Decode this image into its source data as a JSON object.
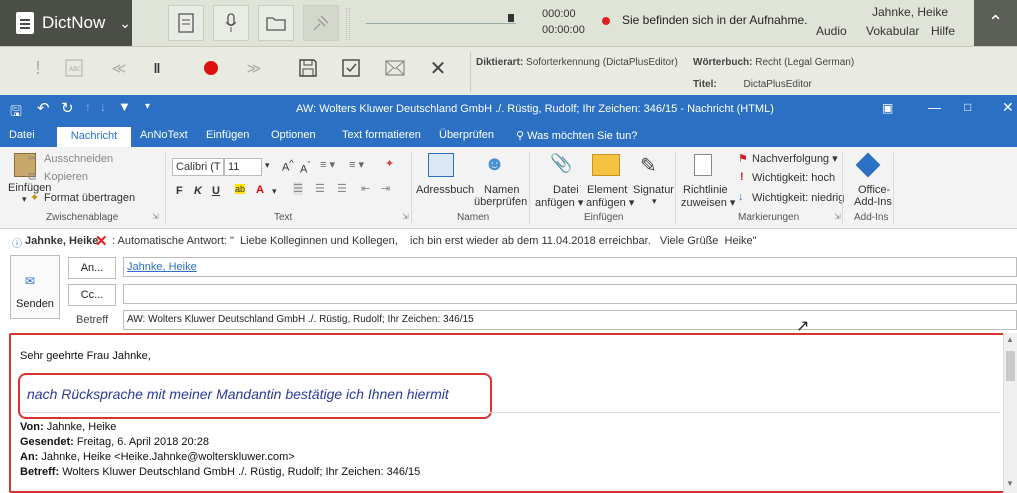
{
  "dictnow": {
    "app_name": "DictNow",
    "time_elapsed": "000:00",
    "time_total": "00:00:00",
    "status_text": "Sie befinden sich in der Aufnahme.",
    "user_name": "Jahnke, Heike",
    "menu": [
      "Audio",
      "Vokabular",
      "Hilfe"
    ],
    "dictation_type_label": "Diktierart:",
    "dictation_type_value": "Soforterkennung (DictaPlusEditor)",
    "dictionary_label": "Wörterbuch:",
    "dictionary_value": "Recht (Legal German)",
    "title_label": "Titel:",
    "title_value": "DictaPlusEditor"
  },
  "outlook": {
    "window_title": "AW: Wolters Kluwer Deutschland GmbH ./. Rüstig, Rudolf; Ihr Zeichen: 346/15 - Nachricht (HTML)",
    "tabs": [
      "Datei",
      "Nachricht",
      "AnNoText",
      "Einfügen",
      "Optionen",
      "Text formatieren",
      "Überprüfen",
      "Was möchten Sie tun?"
    ],
    "ribbon": {
      "paste": "Einfügen",
      "cut": "Ausschneiden",
      "copy": "Kopieren",
      "format_painter": "Format übertragen",
      "font_name": "Calibri (T",
      "font_size": "11",
      "addressbook": "Adressbuch",
      "check_names_1": "Namen",
      "check_names_2": "überprüfen",
      "attach_file_1": "Datei",
      "attach_file_2": "anfügen",
      "attach_item_1": "Element",
      "attach_item_2": "anfügen",
      "signature": "Signatur",
      "policy_1": "Richtlinie",
      "policy_2": "zuweisen",
      "follow_up": "Nachverfolgung",
      "high_importance": "Wichtigkeit: hoch",
      "low_importance": "Wichtigkeit: niedrig",
      "office_addins_1": "Office-",
      "office_addins_2": "Add-Ins",
      "groups": [
        "Zwischenablage",
        "Text",
        "Namen",
        "Einfügen",
        "Markierungen",
        "Add-Ins"
      ]
    },
    "autoreply_sender": "Jahnke, Heike",
    "autoreply_text": ": Automatische Antwort: \"  Liebe Kolleginnen und Kollegen,    ich bin erst wieder ab dem 11.04.2018 erreichbar.   Viele Grüße  Heike\"",
    "send_label": "Senden",
    "to_button": "An...",
    "cc_button": "Cc...",
    "subject_label": "Betreff",
    "to_value": "Jahnke, Heike",
    "subject_value": "AW: Wolters Kluwer Deutschland GmbH ./. Rüstig, Rudolf; Ihr Zeichen: 346/15",
    "body": {
      "greeting": "Sehr geehrte Frau Jahnke,",
      "dictated_text": "nach Rücksprache mit meiner Mandantin bestätige ich Ihnen hiermit",
      "from_label": "Von:",
      "from_value": "Jahnke, Heike",
      "sent_label": "Gesendet:",
      "sent_value": "Freitag, 6. April 2018 20:28",
      "to_label": "An:",
      "to_value": "Jahnke, Heike <Heike.Jahnke@wolterskluwer.com>",
      "subject_label": "Betreff:",
      "subject_value": "Wolters Kluwer Deutschland GmbH ./. Rüstig, Rudolf; Ihr Zeichen: 346/15"
    }
  }
}
